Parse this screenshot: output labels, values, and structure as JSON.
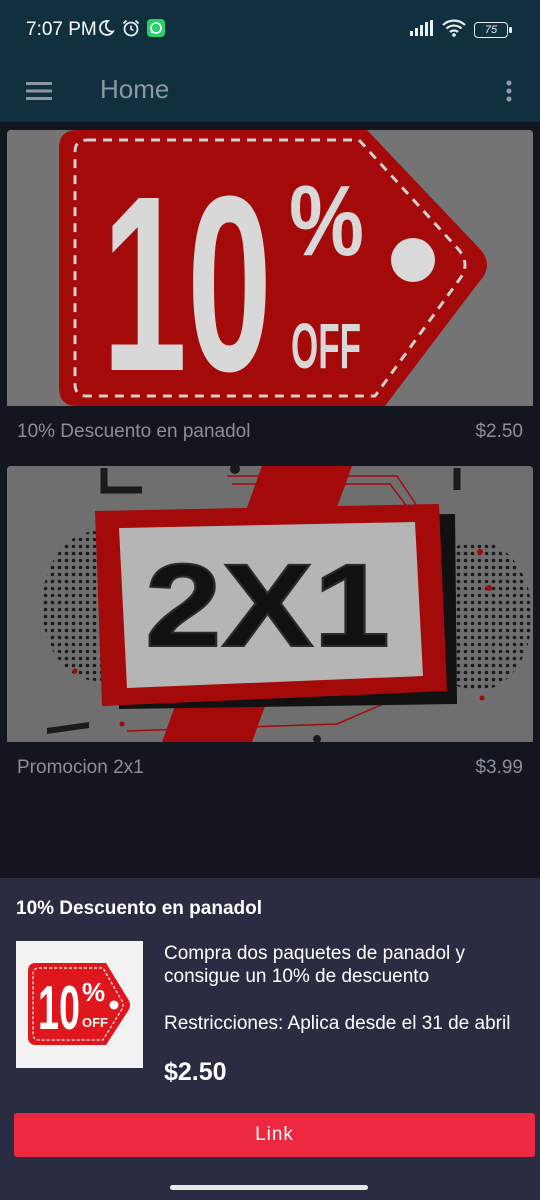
{
  "status_bar": {
    "time": "7:07 PM",
    "battery": "75",
    "icons": [
      "moon-icon",
      "alarm-icon",
      "whatsapp-icon",
      "signal-icon",
      "wifi-icon",
      "battery-icon"
    ]
  },
  "app_bar": {
    "title": "Home",
    "icons": [
      "menu-icon",
      "more-vert-icon"
    ]
  },
  "promos": [
    {
      "title": "10% Descuento en panadol",
      "price": "$2.50",
      "image": {
        "big": "10",
        "percent": "%",
        "off": "OFF"
      }
    },
    {
      "title": "Promocion 2x1",
      "price": "$3.99",
      "image": {
        "text": "2X1"
      }
    }
  ],
  "detail": {
    "title": "10% Descuento en panadol",
    "description": "Compra dos paquetes de panadol y consigue un 10% de descuento",
    "restrictions": "Restricciones: Aplica desde el 31 de abril",
    "price": "$2.50",
    "button_label": "Link",
    "thumb": {
      "big": "10",
      "percent": "%",
      "off": "OFF"
    }
  },
  "colors": {
    "app_bar": "#11303f",
    "background": "#14161f",
    "sheet": "#2a2d42",
    "accent": "#ec2940",
    "promo_red": "#a50a0a"
  }
}
